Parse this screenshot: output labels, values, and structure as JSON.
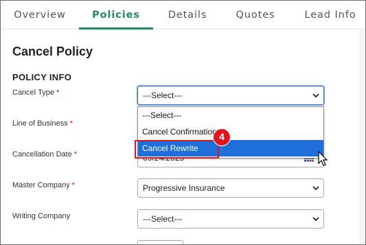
{
  "tabs": [
    {
      "label": "Overview"
    },
    {
      "label": "Policies",
      "active": true
    },
    {
      "label": "Details"
    },
    {
      "label": "Quotes"
    },
    {
      "label": "Lead Info"
    }
  ],
  "page": {
    "title": "Cancel Policy",
    "section_title": "POLICY INFO"
  },
  "fields": {
    "cancel_type": {
      "label": "Cancel Type",
      "required": "*",
      "value": "---Select---"
    },
    "line_of_business": {
      "label": "Line of Business",
      "required": "*"
    },
    "cancellation_date": {
      "label": "Cancellation Date",
      "required": "*",
      "value": "09/24/2025"
    },
    "master_company": {
      "label": "Master Company",
      "required": "*",
      "value": "Progressive Insurance"
    },
    "writing_company": {
      "label": "Writing Company",
      "value": "---Select---"
    }
  },
  "dropdown": {
    "options": [
      "---Select---",
      "Cancel Confirmation",
      "Cancel Rewrite"
    ],
    "highlighted": "Cancel Rewrite"
  },
  "annotation": {
    "step": "4",
    "color": "#e0141e"
  },
  "colors": {
    "accent": "#1f8a5f",
    "highlight": "#1e6fd9"
  }
}
